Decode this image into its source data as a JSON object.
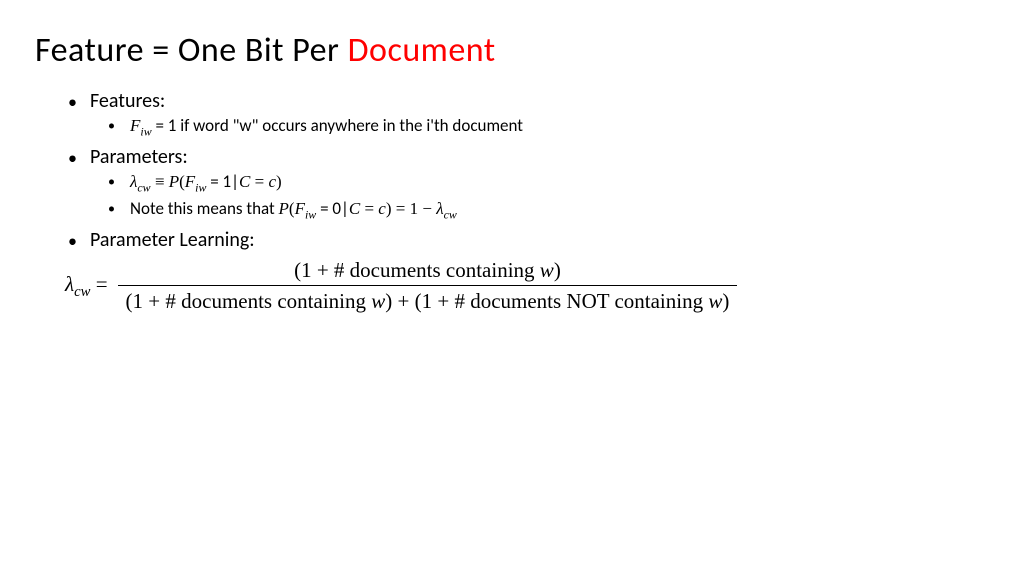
{
  "title": {
    "prefix": "Feature = One Bit Per ",
    "highlight": "Document"
  },
  "bullets": {
    "features_label": "Features:",
    "features_item": " = 1 if word \"w\" occurs anywhere in the i'th document",
    "parameters_label": "Parameters:",
    "param_def_mid": " = 1|",
    "param_note_prefix": "Note this means that ",
    "param_note_mid": " = 0|",
    "param_note_end": " = 1 − ",
    "learning_label": "Parameter Learning:"
  },
  "math": {
    "F": "F",
    "iw": "iw",
    "lambda": "λ",
    "cw": "cw",
    "equiv": " ≡ ",
    "P": "P",
    "C": "C",
    "c": "c",
    "eq": " = ",
    "open": "(",
    "close": ")"
  },
  "formula": {
    "lhs_eq": " = ",
    "num": "(1 + # documents containing ",
    "num_end": ")",
    "den_a": "(1 + # documents containing ",
    "den_mid": ") + (1 + # documents NOT containing ",
    "den_end": ")",
    "w": "w"
  }
}
